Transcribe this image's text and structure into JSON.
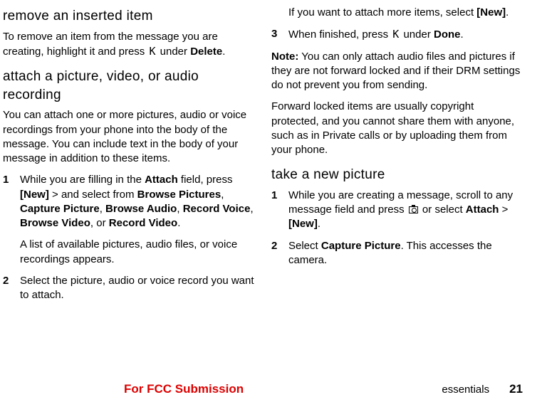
{
  "left": {
    "heading1": "remove an inserted item",
    "para1a": "To remove an item from the message you are creating, highlight it and press ",
    "key1": "K",
    "para1b": " under ",
    "delete": "Delete",
    "para1c": ".",
    "heading2": "attach a picture, video, or audio recording",
    "para2": "You can attach one or more pictures, audio or voice recordings from your phone into the body of the message. You can include text in the body of your message in addition to these items.",
    "step1num": "1",
    "step1a": "While you are filling in the ",
    "attach": "Attach",
    "step1b": " field, press ",
    "new": "[New]",
    "step1c": " > and select from ",
    "browsePictures": "Browse Pictures",
    "comma": ", ",
    "capturePicture": "Capture Picture",
    "browseAudio": "Browse Audio",
    "recordVoice": "Record Voice",
    "browseVideo": "Browse Video",
    "or": ", or ",
    "recordVideo": "Record Video",
    "period": ".",
    "step1sub": "A list of available pictures, audio files, or voice recordings appears.",
    "step2num": "2",
    "step2": "Select the picture, audio or voice record you want to attach."
  },
  "right": {
    "para1a": "If you want to attach more items, select ",
    "new": "[New]",
    "period": ".",
    "step3num": "3",
    "step3a": "When finished, press ",
    "key": "K",
    "step3b": " under ",
    "done": "Done",
    "noteLabel": "Note:",
    "noteText": " You can only attach audio files and pictures if they are not forward locked and if their DRM settings do not prevent you from sending.",
    "para2": "Forward locked items are usually copyright protected, and you cannot share them with anyone, such as in Private calls or by uploading them from your phone.",
    "heading": "take a new picture",
    "step1num": "1",
    "step1a": "While you are creating a message, scroll to any message field and press ",
    "step1b": " or select ",
    "attach": "Attach",
    "gt": " > ",
    "newb": "[New]",
    "step2num": "2",
    "step2a": "Select ",
    "capturePicture": "Capture Picture",
    "step2b": ". This accesses the camera."
  },
  "footer": {
    "fcc": "For FCC Submission",
    "section": "essentials",
    "page": "21"
  }
}
